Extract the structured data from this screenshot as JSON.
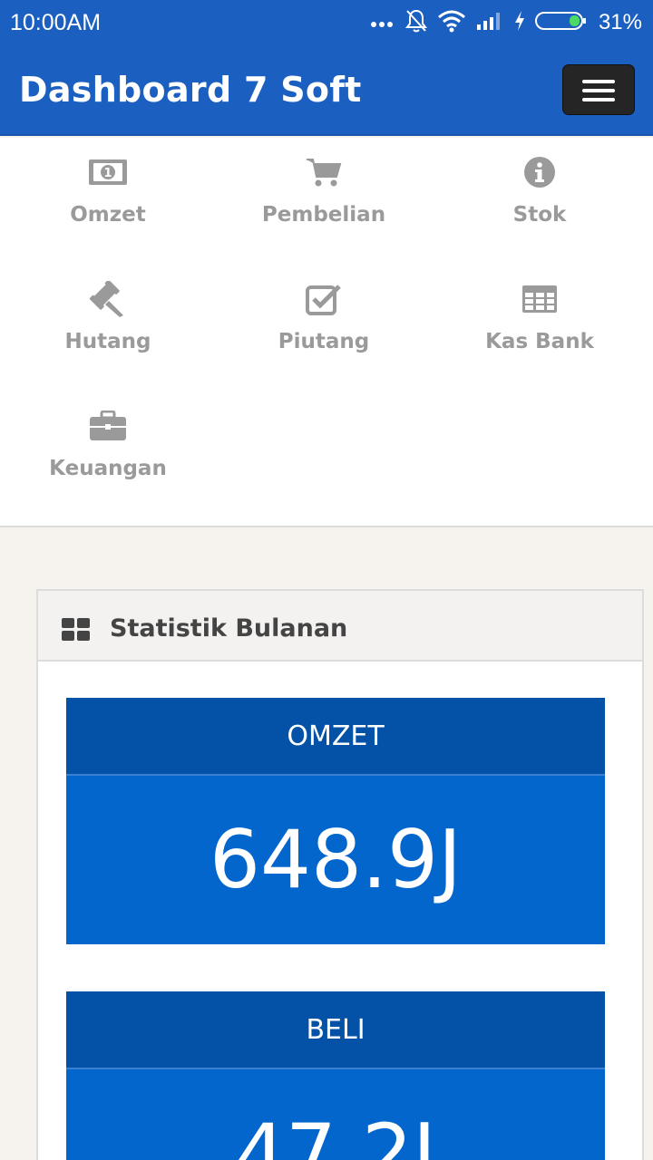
{
  "status_bar": {
    "time": "10:00AM",
    "battery_percent": "31%",
    "icons": [
      "more-dots-icon",
      "bell-off-icon",
      "wifi-icon",
      "signal-icon",
      "charging-bolt-icon",
      "battery-icon"
    ]
  },
  "header": {
    "title": "Dashboard 7 Soft",
    "menu_icon": "hamburger-icon"
  },
  "menu": {
    "items": [
      {
        "label": "Omzet",
        "icon": "money-icon"
      },
      {
        "label": "Pembelian",
        "icon": "cart-icon"
      },
      {
        "label": "Stok",
        "icon": "info-icon"
      },
      {
        "label": "Hutang",
        "icon": "gavel-icon"
      },
      {
        "label": "Piutang",
        "icon": "checkbox-icon"
      },
      {
        "label": "Kas Bank",
        "icon": "table-icon"
      },
      {
        "label": "Keuangan",
        "icon": "briefcase-icon"
      }
    ]
  },
  "panel": {
    "title": "Statistik Bulanan",
    "icon": "dashboard-icon",
    "stats": [
      {
        "label": "OMZET",
        "value": "648.9J"
      },
      {
        "label": "BELI",
        "value": "47.2J"
      }
    ]
  },
  "colors": {
    "primary": "#1b5fc1",
    "stat_head": "#0452a8",
    "stat_body": "#0366cd",
    "menu_text": "#9a9a9a"
  }
}
